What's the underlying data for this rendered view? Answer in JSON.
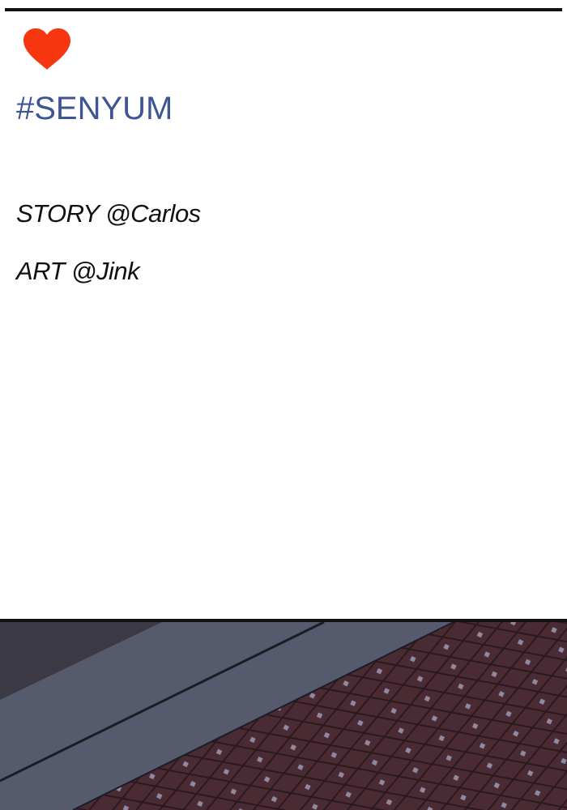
{
  "header": {
    "hashtag": "#SENYUM",
    "hashtag_color": "#3d5593",
    "heart_color": "#f5360e"
  },
  "credits": {
    "story": "STORY @Carlos",
    "art": "ART @Jink"
  },
  "panel": {
    "colors": {
      "wall_dark": "#3a3944",
      "ledge": "#555b6d",
      "ledge_edge": "#1b1c24",
      "tile_base": "#4a2a33",
      "tile_line": "#2a1820",
      "tile_dot": "#8e8aa3"
    }
  }
}
